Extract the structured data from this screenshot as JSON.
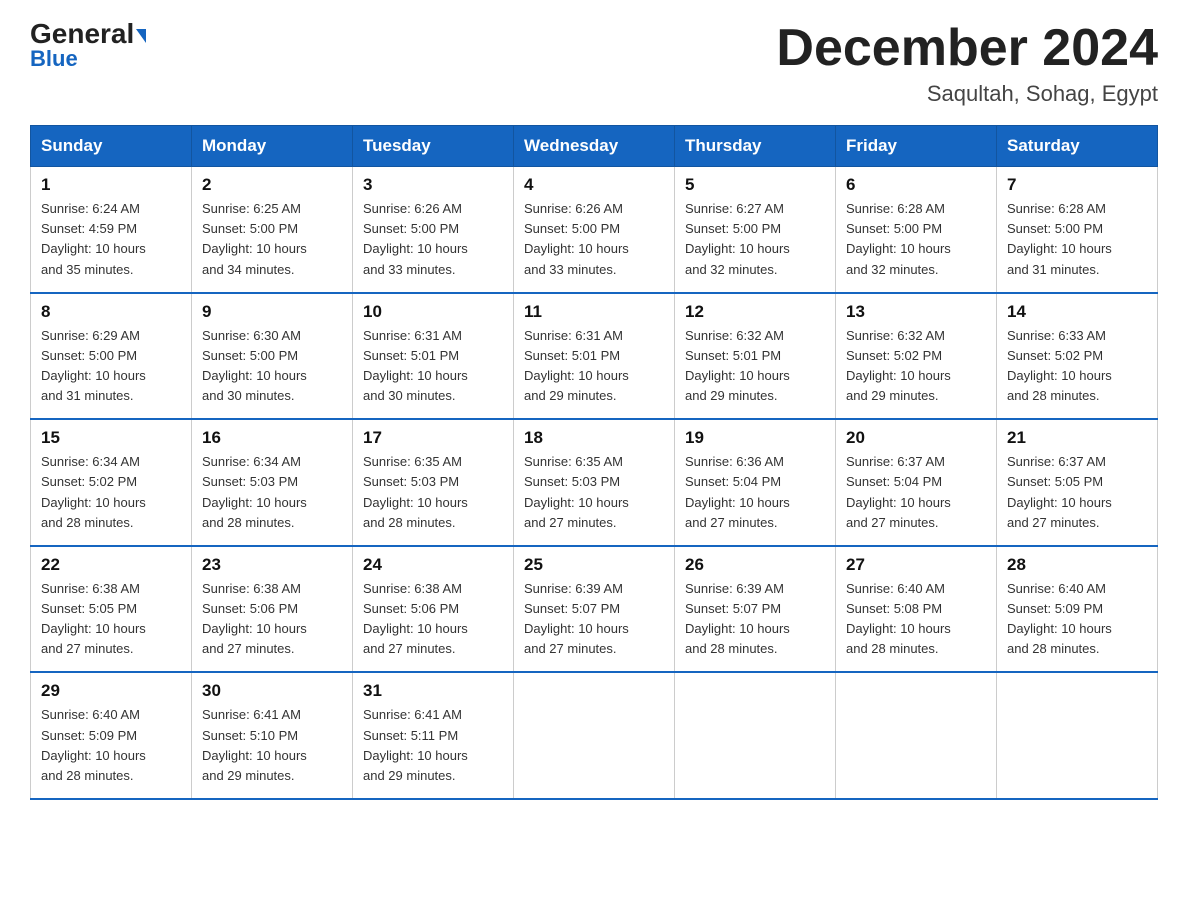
{
  "logo": {
    "part1": "General",
    "part2": "Blue"
  },
  "title": {
    "month": "December 2024",
    "location": "Saqultah, Sohag, Egypt"
  },
  "days": [
    "Sunday",
    "Monday",
    "Tuesday",
    "Wednesday",
    "Thursday",
    "Friday",
    "Saturday"
  ],
  "weeks": [
    [
      {
        "num": "1",
        "sunrise": "6:24 AM",
        "sunset": "4:59 PM",
        "daylight": "10 hours and 35 minutes."
      },
      {
        "num": "2",
        "sunrise": "6:25 AM",
        "sunset": "5:00 PM",
        "daylight": "10 hours and 34 minutes."
      },
      {
        "num": "3",
        "sunrise": "6:26 AM",
        "sunset": "5:00 PM",
        "daylight": "10 hours and 33 minutes."
      },
      {
        "num": "4",
        "sunrise": "6:26 AM",
        "sunset": "5:00 PM",
        "daylight": "10 hours and 33 minutes."
      },
      {
        "num": "5",
        "sunrise": "6:27 AM",
        "sunset": "5:00 PM",
        "daylight": "10 hours and 32 minutes."
      },
      {
        "num": "6",
        "sunrise": "6:28 AM",
        "sunset": "5:00 PM",
        "daylight": "10 hours and 32 minutes."
      },
      {
        "num": "7",
        "sunrise": "6:28 AM",
        "sunset": "5:00 PM",
        "daylight": "10 hours and 31 minutes."
      }
    ],
    [
      {
        "num": "8",
        "sunrise": "6:29 AM",
        "sunset": "5:00 PM",
        "daylight": "10 hours and 31 minutes."
      },
      {
        "num": "9",
        "sunrise": "6:30 AM",
        "sunset": "5:00 PM",
        "daylight": "10 hours and 30 minutes."
      },
      {
        "num": "10",
        "sunrise": "6:31 AM",
        "sunset": "5:01 PM",
        "daylight": "10 hours and 30 minutes."
      },
      {
        "num": "11",
        "sunrise": "6:31 AM",
        "sunset": "5:01 PM",
        "daylight": "10 hours and 29 minutes."
      },
      {
        "num": "12",
        "sunrise": "6:32 AM",
        "sunset": "5:01 PM",
        "daylight": "10 hours and 29 minutes."
      },
      {
        "num": "13",
        "sunrise": "6:32 AM",
        "sunset": "5:02 PM",
        "daylight": "10 hours and 29 minutes."
      },
      {
        "num": "14",
        "sunrise": "6:33 AM",
        "sunset": "5:02 PM",
        "daylight": "10 hours and 28 minutes."
      }
    ],
    [
      {
        "num": "15",
        "sunrise": "6:34 AM",
        "sunset": "5:02 PM",
        "daylight": "10 hours and 28 minutes."
      },
      {
        "num": "16",
        "sunrise": "6:34 AM",
        "sunset": "5:03 PM",
        "daylight": "10 hours and 28 minutes."
      },
      {
        "num": "17",
        "sunrise": "6:35 AM",
        "sunset": "5:03 PM",
        "daylight": "10 hours and 28 minutes."
      },
      {
        "num": "18",
        "sunrise": "6:35 AM",
        "sunset": "5:03 PM",
        "daylight": "10 hours and 27 minutes."
      },
      {
        "num": "19",
        "sunrise": "6:36 AM",
        "sunset": "5:04 PM",
        "daylight": "10 hours and 27 minutes."
      },
      {
        "num": "20",
        "sunrise": "6:37 AM",
        "sunset": "5:04 PM",
        "daylight": "10 hours and 27 minutes."
      },
      {
        "num": "21",
        "sunrise": "6:37 AM",
        "sunset": "5:05 PM",
        "daylight": "10 hours and 27 minutes."
      }
    ],
    [
      {
        "num": "22",
        "sunrise": "6:38 AM",
        "sunset": "5:05 PM",
        "daylight": "10 hours and 27 minutes."
      },
      {
        "num": "23",
        "sunrise": "6:38 AM",
        "sunset": "5:06 PM",
        "daylight": "10 hours and 27 minutes."
      },
      {
        "num": "24",
        "sunrise": "6:38 AM",
        "sunset": "5:06 PM",
        "daylight": "10 hours and 27 minutes."
      },
      {
        "num": "25",
        "sunrise": "6:39 AM",
        "sunset": "5:07 PM",
        "daylight": "10 hours and 27 minutes."
      },
      {
        "num": "26",
        "sunrise": "6:39 AM",
        "sunset": "5:07 PM",
        "daylight": "10 hours and 28 minutes."
      },
      {
        "num": "27",
        "sunrise": "6:40 AM",
        "sunset": "5:08 PM",
        "daylight": "10 hours and 28 minutes."
      },
      {
        "num": "28",
        "sunrise": "6:40 AM",
        "sunset": "5:09 PM",
        "daylight": "10 hours and 28 minutes."
      }
    ],
    [
      {
        "num": "29",
        "sunrise": "6:40 AM",
        "sunset": "5:09 PM",
        "daylight": "10 hours and 28 minutes."
      },
      {
        "num": "30",
        "sunrise": "6:41 AM",
        "sunset": "5:10 PM",
        "daylight": "10 hours and 29 minutes."
      },
      {
        "num": "31",
        "sunrise": "6:41 AM",
        "sunset": "5:11 PM",
        "daylight": "10 hours and 29 minutes."
      },
      null,
      null,
      null,
      null
    ]
  ],
  "labels": {
    "sunrise": "Sunrise:",
    "sunset": "Sunset:",
    "daylight": "Daylight:"
  }
}
